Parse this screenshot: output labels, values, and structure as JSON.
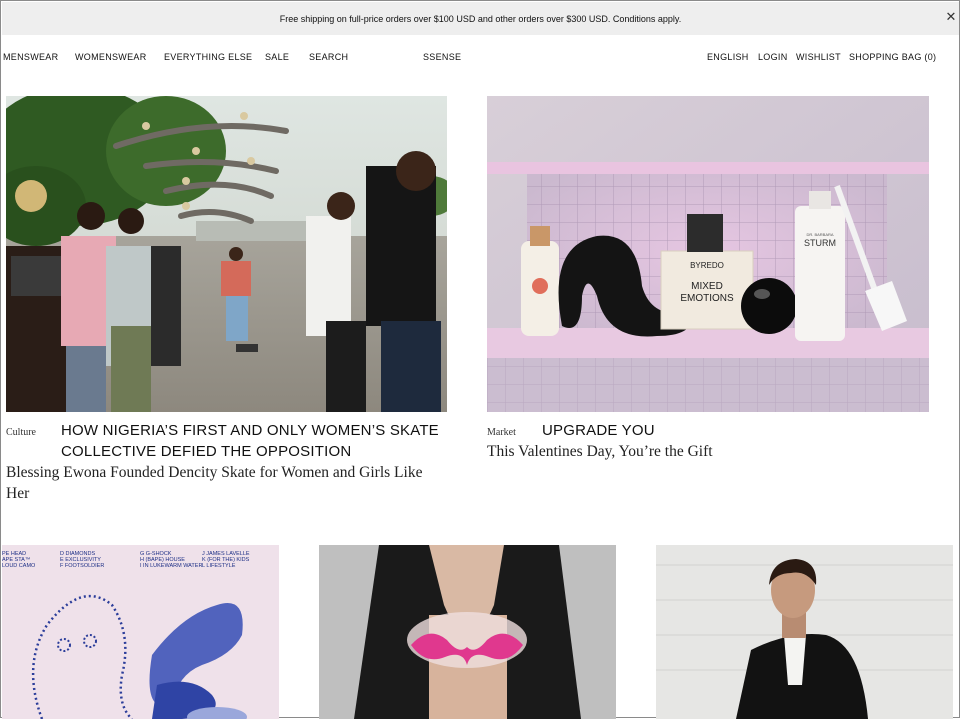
{
  "banner": {
    "text": "Free shipping on full-price orders over $100 USD and other orders over $300 USD. Conditions apply.",
    "close_glyph": "✕"
  },
  "nav": {
    "left": [
      "MENSWEAR",
      "WOMENSWEAR",
      "EVERYTHING ELSE",
      "SALE",
      "SEARCH"
    ],
    "logo": "SSENSE",
    "right": [
      "ENGLISH",
      "LOGIN",
      "WISHLIST",
      "SHOPPING BAG (0)"
    ]
  },
  "features": [
    {
      "category": "Culture",
      "headline": "HOW NIGERIA’S FIRST AND ONLY WOMEN’S SKATE COLLECTIVE DEFIED THE OPPOSITION",
      "subtitle": "Blessing Ewona Founded Dencity Skate for Women and Girls Like Her"
    },
    {
      "category": "Market",
      "headline": "UPGRADE YOU",
      "subtitle": "This Valentines Day, You’re the Gift"
    }
  ],
  "product_labels": {
    "perfume_brand": "BYREDO",
    "perfume_name_1": "MIXED",
    "perfume_name_2": "EMOTIONS",
    "bottle_brand": "DR. BARBARA",
    "bottle_name": "STURM"
  },
  "poster_text": {
    "col1": [
      "PE HEAD",
      "APE STA™",
      "LOUD CAMO"
    ],
    "col2": [
      "D  DIAMONDS",
      "E  EXCLUSIVITY",
      "F  FOOTSOLDIER"
    ],
    "col3": [
      "G  G-SHOCK",
      "H  (BAPE) HOUSE",
      "I  IN LUKEWARM WATER"
    ],
    "col4": [
      "J  JAMES LAVELLE",
      "K  (FOR THE) KIDS",
      "L  LIFESTYLE"
    ]
  }
}
